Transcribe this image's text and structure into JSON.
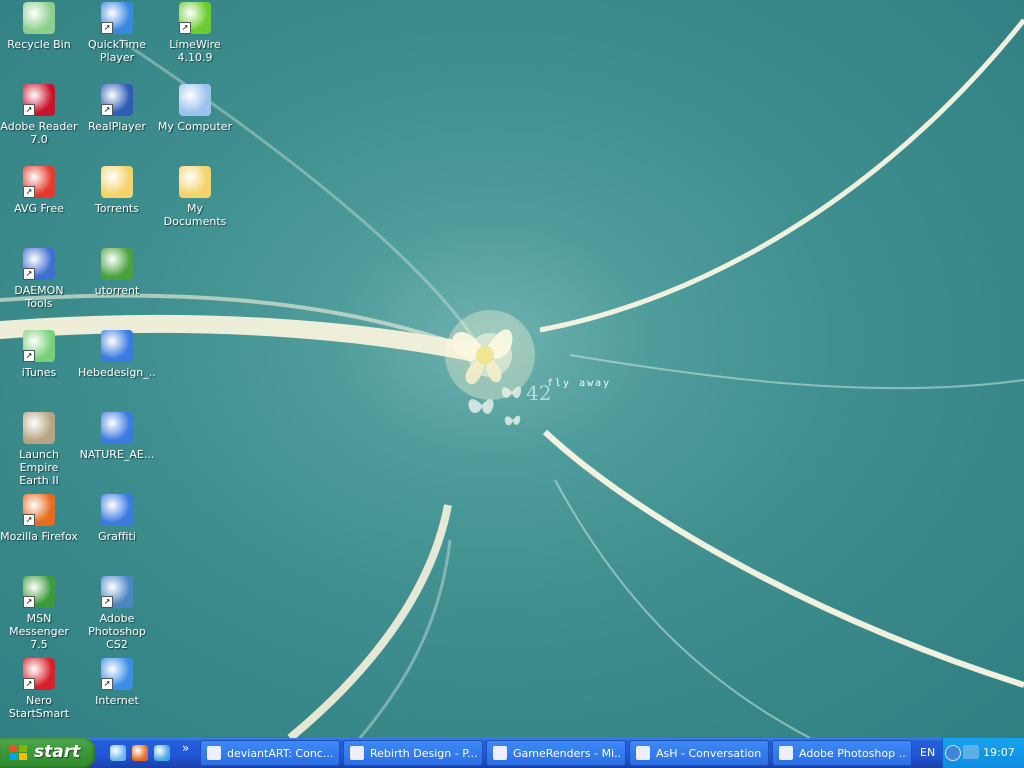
{
  "desktop": {
    "wallpaper": {
      "title": "fly away"
    },
    "icons": [
      {
        "id": "recycle-bin",
        "label": "Recycle Bin",
        "icon": "recycle-bin-icon",
        "shortcut": false,
        "color": "#8cd08c"
      },
      {
        "id": "quicktime",
        "label": "QuickTime\nPlayer",
        "icon": "quicktime-icon",
        "shortcut": true,
        "color": "#3a87e0"
      },
      {
        "id": "limewire",
        "label": "LimeWire\n4.10.9",
        "icon": "limewire-icon",
        "shortcut": true,
        "color": "#6ccc2f"
      },
      {
        "id": "adobe-reader",
        "label": "Adobe Reader\n7.0",
        "icon": "adobe-reader-icon",
        "shortcut": true,
        "color": "#c8142b"
      },
      {
        "id": "realplayer",
        "label": "RealPlayer",
        "icon": "realplayer-icon",
        "shortcut": true,
        "color": "#2f5cb5"
      },
      {
        "id": "my-computer",
        "label": "My Computer",
        "icon": "my-computer-icon",
        "shortcut": false,
        "color": "#9cc3ee"
      },
      {
        "id": "avg-free",
        "label": "AVG Free",
        "icon": "avg-icon",
        "shortcut": true,
        "color": "#e23b2b"
      },
      {
        "id": "torrents",
        "label": "Torrents",
        "icon": "folder-icon",
        "shortcut": false,
        "color": "#f3d36b"
      },
      {
        "id": "my-documents",
        "label": "My Documents",
        "icon": "my-documents-icon",
        "shortcut": false,
        "color": "#f3d36b"
      },
      {
        "id": "daemon-tools",
        "label": "DAEMON Tools",
        "icon": "daemon-tools-icon",
        "shortcut": true,
        "color": "#3f6fd0"
      },
      {
        "id": "utorrent",
        "label": "utorrent",
        "icon": "utorrent-icon",
        "shortcut": false,
        "color": "#4aa23e"
      },
      {
        "id": "itunes",
        "label": "iTunes",
        "icon": "itunes-icon",
        "shortcut": true,
        "color": "#7ad07a"
      },
      {
        "id": "hebedesign",
        "label": "Hebedesign_...",
        "icon": "shapes-puzzle-icon",
        "shortcut": false,
        "color": "#3b7ae0"
      },
      {
        "id": "empire-earth",
        "label": "Launch Empire\nEarth II",
        "icon": "empire-earth-icon",
        "shortcut": false,
        "color": "#b7a482"
      },
      {
        "id": "nature-ae",
        "label": "NATURE_AE...",
        "icon": "shapes-puzzle-icon",
        "shortcut": false,
        "color": "#3b7ae0"
      },
      {
        "id": "firefox",
        "label": "Mozilla Firefox",
        "icon": "firefox-icon",
        "shortcut": true,
        "color": "#e66b1e"
      },
      {
        "id": "graffiti",
        "label": "Graffiti",
        "icon": "shapes-puzzle-icon",
        "shortcut": false,
        "color": "#3b7ae0"
      },
      {
        "id": "msn",
        "label": "MSN\nMessenger 7.5",
        "icon": "msn-messenger-icon",
        "shortcut": true,
        "color": "#3c9a3a"
      },
      {
        "id": "photoshop",
        "label": "Adobe\nPhotoshop CS2",
        "icon": "photoshop-icon",
        "shortcut": true,
        "color": "#4c87c4"
      },
      {
        "id": "nero",
        "label": "Nero\nStartSmart",
        "icon": "nero-icon",
        "shortcut": true,
        "color": "#d6222a"
      },
      {
        "id": "internet",
        "label": "Internet",
        "icon": "internet-explorer-icon",
        "shortcut": true,
        "color": "#3a8ee6"
      }
    ]
  },
  "taskbar": {
    "start_label": "start",
    "quick_launch": [
      {
        "icon": "show-desktop-icon",
        "color": "#6db6ea"
      },
      {
        "icon": "firefox-icon",
        "color": "#e66b1e"
      },
      {
        "icon": "msn-messenger-icon",
        "color": "#45a8e0"
      }
    ],
    "overflow": "»",
    "windows": [
      {
        "label": "deviantART: Conc...",
        "icon": "ie-window-icon"
      },
      {
        "label": "Rebirth Design - P...",
        "icon": "ie-window-icon"
      },
      {
        "label": "GameRenders - Mi...",
        "icon": "ie-window-icon"
      },
      {
        "label": "AsH - Conversation",
        "icon": "msn-chat-icon"
      },
      {
        "label": "Adobe Photoshop ...",
        "icon": "photoshop-icon"
      }
    ],
    "language": "EN",
    "clock": "19:07"
  }
}
